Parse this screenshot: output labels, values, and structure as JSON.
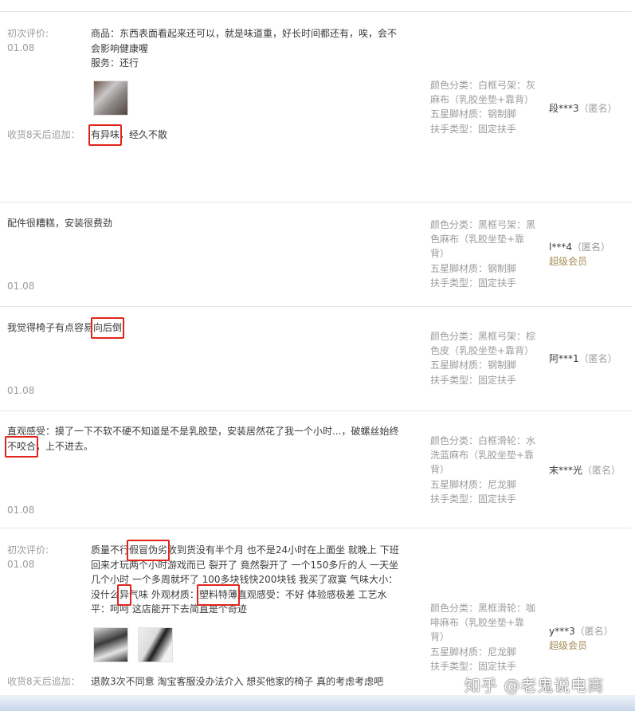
{
  "reviews": [
    {
      "first_label": "初次评价:",
      "date": "01.08",
      "product_text": "商品：东西表面看起来还可以，就是味道重，好长时间都还有，唉，会不会影响健康喔",
      "service_text": "服务：还行",
      "followup_label": "收货8天后追加：",
      "followup_highlight": "有异味",
      "followup_rest": "，经久不散",
      "sku": [
        "颜色分类：白框弓架：灰麻布（乳胶坐垫+靠背）",
        "五星脚材质：钢制脚",
        "扶手类型：固定扶手"
      ],
      "user": "段***3",
      "anon": "（匿名）"
    },
    {
      "text": "配件很糟糕，安装很费劲",
      "date": "01.08",
      "sku": [
        "颜色分类：黑框弓架：黑色麻布（乳胶坐垫+靠背）",
        "五星脚材质：钢制脚",
        "扶手类型：固定扶手"
      ],
      "user": "l***4",
      "anon": "（匿名）",
      "badge": "超级会员"
    },
    {
      "text_before": "我觉得椅子有点容易",
      "highlight": "向后倒",
      "date": "01.08",
      "sku": [
        "颜色分类：黑框弓架：棕色皮（乳胶坐垫+靠背）",
        "五星脚材质：钢制脚",
        "扶手类型：固定扶手"
      ],
      "user": "阿***1",
      "anon": "（匿名）"
    },
    {
      "text_before": "直观感受：摸了一下不软不硬不知道是不是乳胶垫，安装居然花了我一个小时...，破螺丝始终",
      "highlight": "不咬合",
      "text_after": "，上不进去。",
      "date": "01.08",
      "sku": [
        "颜色分类：白框滑轮：水洗蓝麻布（乳胶坐垫+靠背）",
        "五星脚材质：尼龙脚",
        "扶手类型：固定扶手"
      ],
      "user": "末***光",
      "anon": "（匿名）"
    },
    {
      "first_label": "初次评价:",
      "date": "01.08",
      "t1": "质量不行",
      "h1": "假冒伪劣",
      "t2": "收到货没有半个月 也不是24小时在上面坐 就晚上 下班回来才玩两个小时游戏而已 裂开了 竟然裂开了 一个150多斤的人 一天坐几个小时 一个多周就坏了 100多块钱快200块钱 我买了寂寞 气味大小：没什么",
      "h2": "异",
      "t3": "气味 外观材质：",
      "h3": "塑料特薄",
      "t4": "直观感受：不好 体验感极差 工艺水平：呵呵 这店能开下去简直是个奇迹",
      "followup_label": "收货8天后追加：",
      "followup_text": "退款3次不同意 淘宝客服没办法介入 想买他家的椅子 真的考虑考虑吧",
      "sku": [
        "颜色分类：黑框滑轮：咖啡麻布（乳胶坐垫+靠背）",
        "五星脚材质：尼龙脚",
        "扶手类型：固定扶手"
      ],
      "user": "y***3",
      "anon": "（匿名）",
      "badge": "超级会员"
    }
  ],
  "watermark": "知乎 @老鬼说电商",
  "colors": {
    "highlight_box": "#e0241b",
    "vip": "#a58e55",
    "muted": "#9c9c9c"
  }
}
